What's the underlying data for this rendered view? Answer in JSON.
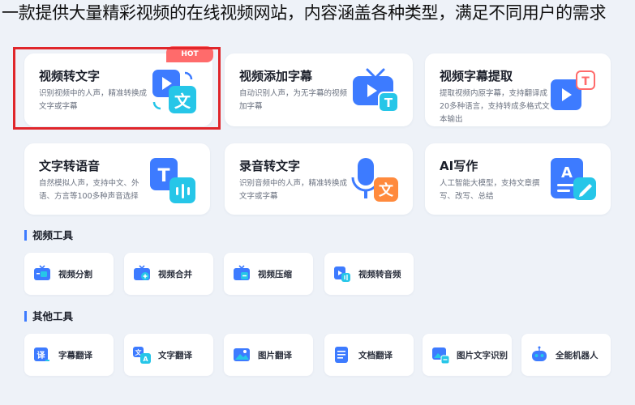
{
  "caption": "一款提供大量精彩视频的在线视频网站，内容涵盖各种类型，满足不同用户的需求",
  "header_partial": "",
  "hot_badge": "HOT",
  "feature_cards": [
    {
      "title": "视频转文字",
      "desc": "识别视频中的人声，精准转换成文字或字幕"
    },
    {
      "title": "视频添加字幕",
      "desc": "自动识别人声，为无字幕的视频加字幕"
    },
    {
      "title": "视频字幕提取",
      "desc": "提取视频内原字幕，支持翻译成20多种语言，支持转成多格式文本输出"
    },
    {
      "title": "文字转语音",
      "desc": "自然模拟人声，支持中文、外语、方言等100多种声音选择"
    },
    {
      "title": "录音转文字",
      "desc": "识别音频中的人声，精准转换成文字或字幕"
    },
    {
      "title": "AI写作",
      "desc": "人工智能大模型，支持文章撰写、改写、总结"
    }
  ],
  "video_tools": {
    "title": "视频工具",
    "items": [
      {
        "label": "视频分割"
      },
      {
        "label": "视频合并"
      },
      {
        "label": "视频压缩"
      },
      {
        "label": "视频转音频"
      }
    ]
  },
  "other_tools": {
    "title": "其他工具",
    "items": [
      {
        "label": "字幕翻译"
      },
      {
        "label": "文字翻译"
      },
      {
        "label": "图片翻译"
      },
      {
        "label": "文档翻译"
      },
      {
        "label": "图片文字识别"
      },
      {
        "label": "全能机器人"
      }
    ]
  },
  "colors": {
    "accent": "#3d7bff",
    "cyan": "#26c6e8",
    "hot": "#ff6b6b",
    "highlight": "#e0262b",
    "orange": "#ff8a3d"
  }
}
